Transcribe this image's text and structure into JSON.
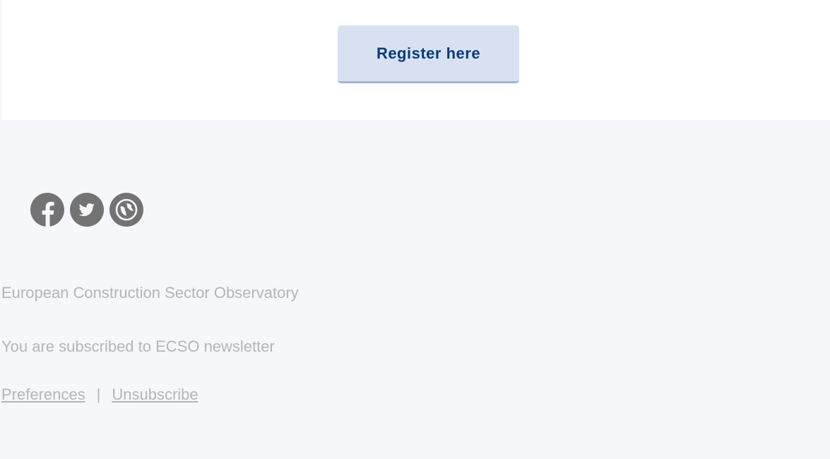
{
  "cta": {
    "register_label": "Register here"
  },
  "social": {
    "items": [
      {
        "name": "facebook-icon"
      },
      {
        "name": "twitter-icon"
      },
      {
        "name": "website-icon"
      }
    ]
  },
  "footer": {
    "org_name": "European Construction Sector Observatory",
    "subscription_text": "You are subscribed to ECSO newsletter",
    "preferences_label": "Preferences",
    "separator": "|",
    "unsubscribe_label": "Unsubscribe"
  },
  "colors": {
    "button_bg": "#d8e1f2",
    "button_text": "#0b3a78",
    "footer_bg": "#f5f7fb",
    "icon_bg": "#737373",
    "muted_text": "#b5b5b5"
  }
}
